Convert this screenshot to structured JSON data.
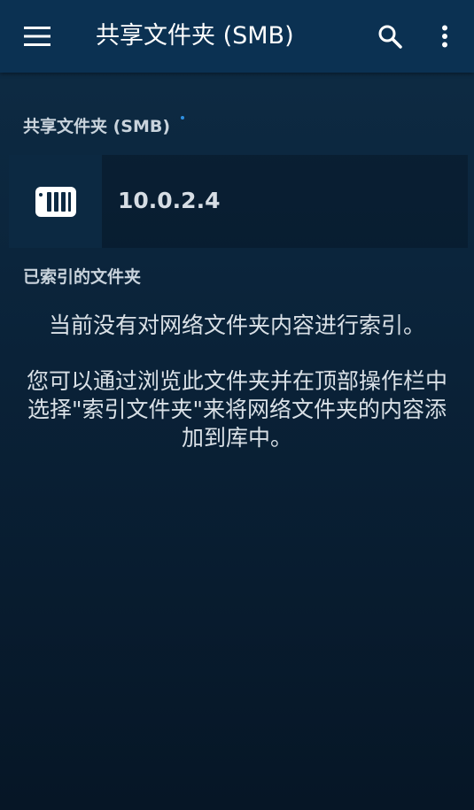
{
  "app_bar": {
    "title": "共享文件夹 (SMB)",
    "icons": [
      "menu-icon",
      "search-icon",
      "more-vert-icon"
    ]
  },
  "share_section": {
    "header": "共享文件夹 (SMB)",
    "servers": [
      {
        "label": "10.0.2.4",
        "icon": "nas-server-icon"
      }
    ]
  },
  "indexed_section": {
    "header": "已索引的文件夹",
    "empty_message": "当前没有对网络文件夹内容进行索引。",
    "hint_lines": [
      "您可以通过浏览此文件夹并在顶部操作栏中",
      "选择\"索引文件夹\"来将网络文件夹的内容添",
      "加到库中。"
    ]
  },
  "colors": {
    "app_bar": "#0b3152",
    "accent_dot": "#2f8fe0",
    "background": "#0a2238"
  }
}
